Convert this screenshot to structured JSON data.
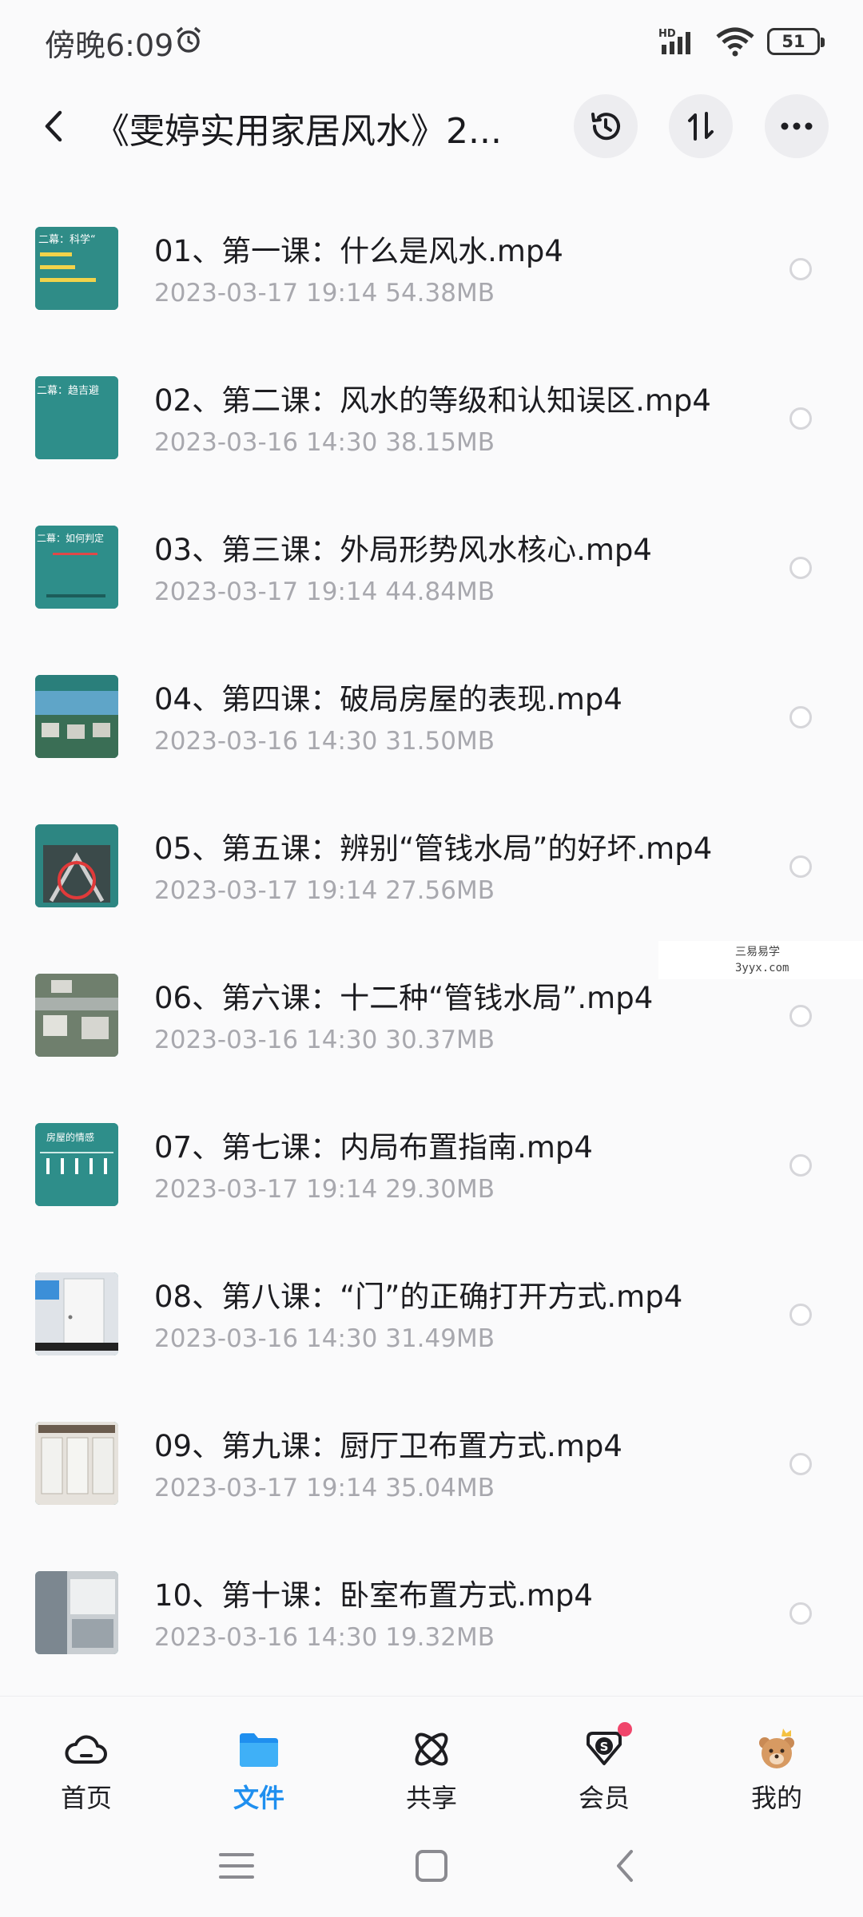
{
  "status_bar": {
    "time": "傍晚6:09",
    "battery": "51",
    "network": "HD"
  },
  "header": {
    "title": "《雯婷实用家居风水》2..."
  },
  "files": [
    {
      "name": "01、第一课：什么是风水.mp4",
      "date": "2023-03-17",
      "time": "19:14",
      "size": "54.38MB",
      "thumb_text": "二幕：科学“"
    },
    {
      "name": "02、第二课：风水的等级和认知误区.mp4",
      "date": "2023-03-16",
      "time": "14:30",
      "size": "38.15MB",
      "thumb_text": "二幕：趋吉避"
    },
    {
      "name": "03、第三课：外局形势风水核心.mp4",
      "date": "2023-03-17",
      "time": "19:14",
      "size": "44.84MB",
      "thumb_text": "二幕：如何判定"
    },
    {
      "name": "04、第四课：破局房屋的表现.mp4",
      "date": "2023-03-16",
      "time": "14:30",
      "size": "31.50MB",
      "thumb_text": ""
    },
    {
      "name": "05、第五课：辨别“管钱水局”的好坏.mp4",
      "date": "2023-03-17",
      "time": "19:14",
      "size": "27.56MB",
      "thumb_text": ""
    },
    {
      "name": "06、第六课：十二种“管钱水局”.mp4",
      "date": "2023-03-16",
      "time": "14:30",
      "size": "30.37MB",
      "thumb_text": ""
    },
    {
      "name": "07、第七课：内局布置指南.mp4",
      "date": "2023-03-17",
      "time": "19:14",
      "size": "29.30MB",
      "thumb_text": "房屋的情感"
    },
    {
      "name": "08、第八课：“门”的正确打开方式.mp4",
      "date": "2023-03-16",
      "time": "14:30",
      "size": "31.49MB",
      "thumb_text": ""
    },
    {
      "name": "09、第九课：厨厅卫布置方式.mp4",
      "date": "2023-03-17",
      "time": "19:14",
      "size": "35.04MB",
      "thumb_text": ""
    },
    {
      "name": "10、第十课：卧室布置方式.mp4",
      "date": "2023-03-16",
      "time": "14:30",
      "size": "19.32MB",
      "thumb_text": ""
    }
  ],
  "watermark": {
    "line1": "三易易学",
    "line2": "3yyx.com"
  },
  "tabs": [
    {
      "label": "首页",
      "icon": "cloud-home-icon",
      "active": false
    },
    {
      "label": "文件",
      "icon": "folder-icon",
      "active": true
    },
    {
      "label": "共享",
      "icon": "atom-share-icon",
      "active": false
    },
    {
      "label": "会员",
      "icon": "vip-diamond-icon",
      "active": false
    },
    {
      "label": "我的",
      "icon": "bear-avatar-icon",
      "active": false
    }
  ],
  "colors": {
    "accent": "#1f8fef",
    "badge": "#f0456b",
    "thumb_teal": "#2d8a86"
  }
}
